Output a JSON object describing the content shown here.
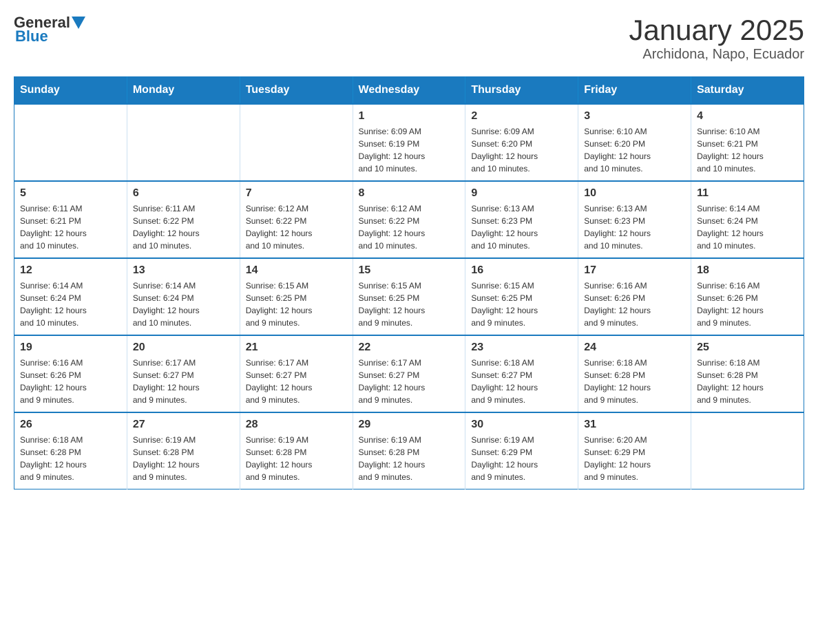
{
  "logo": {
    "general": "General",
    "blue": "Blue"
  },
  "title": "January 2025",
  "location": "Archidona, Napo, Ecuador",
  "days_of_week": [
    "Sunday",
    "Monday",
    "Tuesday",
    "Wednesday",
    "Thursday",
    "Friday",
    "Saturday"
  ],
  "weeks": [
    [
      {
        "day": "",
        "info": ""
      },
      {
        "day": "",
        "info": ""
      },
      {
        "day": "",
        "info": ""
      },
      {
        "day": "1",
        "info": "Sunrise: 6:09 AM\nSunset: 6:19 PM\nDaylight: 12 hours\nand 10 minutes."
      },
      {
        "day": "2",
        "info": "Sunrise: 6:09 AM\nSunset: 6:20 PM\nDaylight: 12 hours\nand 10 minutes."
      },
      {
        "day": "3",
        "info": "Sunrise: 6:10 AM\nSunset: 6:20 PM\nDaylight: 12 hours\nand 10 minutes."
      },
      {
        "day": "4",
        "info": "Sunrise: 6:10 AM\nSunset: 6:21 PM\nDaylight: 12 hours\nand 10 minutes."
      }
    ],
    [
      {
        "day": "5",
        "info": "Sunrise: 6:11 AM\nSunset: 6:21 PM\nDaylight: 12 hours\nand 10 minutes."
      },
      {
        "day": "6",
        "info": "Sunrise: 6:11 AM\nSunset: 6:22 PM\nDaylight: 12 hours\nand 10 minutes."
      },
      {
        "day": "7",
        "info": "Sunrise: 6:12 AM\nSunset: 6:22 PM\nDaylight: 12 hours\nand 10 minutes."
      },
      {
        "day": "8",
        "info": "Sunrise: 6:12 AM\nSunset: 6:22 PM\nDaylight: 12 hours\nand 10 minutes."
      },
      {
        "day": "9",
        "info": "Sunrise: 6:13 AM\nSunset: 6:23 PM\nDaylight: 12 hours\nand 10 minutes."
      },
      {
        "day": "10",
        "info": "Sunrise: 6:13 AM\nSunset: 6:23 PM\nDaylight: 12 hours\nand 10 minutes."
      },
      {
        "day": "11",
        "info": "Sunrise: 6:14 AM\nSunset: 6:24 PM\nDaylight: 12 hours\nand 10 minutes."
      }
    ],
    [
      {
        "day": "12",
        "info": "Sunrise: 6:14 AM\nSunset: 6:24 PM\nDaylight: 12 hours\nand 10 minutes."
      },
      {
        "day": "13",
        "info": "Sunrise: 6:14 AM\nSunset: 6:24 PM\nDaylight: 12 hours\nand 10 minutes."
      },
      {
        "day": "14",
        "info": "Sunrise: 6:15 AM\nSunset: 6:25 PM\nDaylight: 12 hours\nand 9 minutes."
      },
      {
        "day": "15",
        "info": "Sunrise: 6:15 AM\nSunset: 6:25 PM\nDaylight: 12 hours\nand 9 minutes."
      },
      {
        "day": "16",
        "info": "Sunrise: 6:15 AM\nSunset: 6:25 PM\nDaylight: 12 hours\nand 9 minutes."
      },
      {
        "day": "17",
        "info": "Sunrise: 6:16 AM\nSunset: 6:26 PM\nDaylight: 12 hours\nand 9 minutes."
      },
      {
        "day": "18",
        "info": "Sunrise: 6:16 AM\nSunset: 6:26 PM\nDaylight: 12 hours\nand 9 minutes."
      }
    ],
    [
      {
        "day": "19",
        "info": "Sunrise: 6:16 AM\nSunset: 6:26 PM\nDaylight: 12 hours\nand 9 minutes."
      },
      {
        "day": "20",
        "info": "Sunrise: 6:17 AM\nSunset: 6:27 PM\nDaylight: 12 hours\nand 9 minutes."
      },
      {
        "day": "21",
        "info": "Sunrise: 6:17 AM\nSunset: 6:27 PM\nDaylight: 12 hours\nand 9 minutes."
      },
      {
        "day": "22",
        "info": "Sunrise: 6:17 AM\nSunset: 6:27 PM\nDaylight: 12 hours\nand 9 minutes."
      },
      {
        "day": "23",
        "info": "Sunrise: 6:18 AM\nSunset: 6:27 PM\nDaylight: 12 hours\nand 9 minutes."
      },
      {
        "day": "24",
        "info": "Sunrise: 6:18 AM\nSunset: 6:28 PM\nDaylight: 12 hours\nand 9 minutes."
      },
      {
        "day": "25",
        "info": "Sunrise: 6:18 AM\nSunset: 6:28 PM\nDaylight: 12 hours\nand 9 minutes."
      }
    ],
    [
      {
        "day": "26",
        "info": "Sunrise: 6:18 AM\nSunset: 6:28 PM\nDaylight: 12 hours\nand 9 minutes."
      },
      {
        "day": "27",
        "info": "Sunrise: 6:19 AM\nSunset: 6:28 PM\nDaylight: 12 hours\nand 9 minutes."
      },
      {
        "day": "28",
        "info": "Sunrise: 6:19 AM\nSunset: 6:28 PM\nDaylight: 12 hours\nand 9 minutes."
      },
      {
        "day": "29",
        "info": "Sunrise: 6:19 AM\nSunset: 6:28 PM\nDaylight: 12 hours\nand 9 minutes."
      },
      {
        "day": "30",
        "info": "Sunrise: 6:19 AM\nSunset: 6:29 PM\nDaylight: 12 hours\nand 9 minutes."
      },
      {
        "day": "31",
        "info": "Sunrise: 6:20 AM\nSunset: 6:29 PM\nDaylight: 12 hours\nand 9 minutes."
      },
      {
        "day": "",
        "info": ""
      }
    ]
  ]
}
